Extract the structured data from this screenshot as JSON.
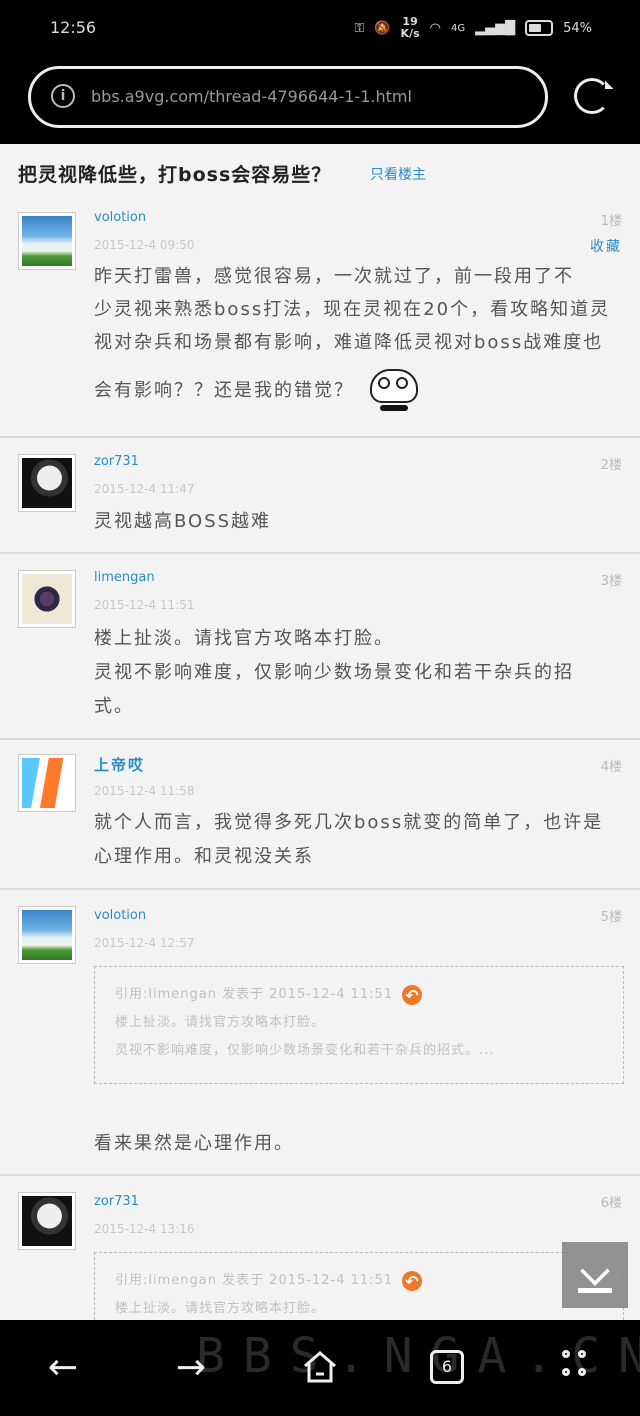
{
  "status_bar": {
    "time": "12:56",
    "net_speed": "19",
    "net_unit": "K/s",
    "network_type": "4G",
    "battery": "54%"
  },
  "browser": {
    "url": "bbs.a9vg.com/thread-4796644-1-1.html"
  },
  "thread": {
    "title": "把灵视降低些，打boss会容易些？",
    "op_only_label": "只看楼主",
    "fav_label": "收藏"
  },
  "posts": [
    {
      "username": "volotion",
      "floor": "1楼",
      "time": "2015-12-4 09:50",
      "lines": [
        "昨天打雷兽，感觉很容易，一次就过了，前一段用了不",
        "少灵视来熟悉boss打法，现在灵视在20个，看攻略知道灵",
        "视对杂兵和场景都有影响，难道降低灵视对boss战难度也",
        "会有影响？？还是我的错觉？"
      ]
    },
    {
      "username": "zor731",
      "floor": "2楼",
      "time": "2015-12-4 11:47",
      "lines": [
        "灵视越高BOSS越难"
      ]
    },
    {
      "username": "limengan",
      "floor": "3楼",
      "time": "2015-12-4 11:51",
      "lines": [
        "楼上扯淡。请找官方攻略本打脸。",
        "灵视不影响难度，仅影响少数场景变化和若干杂兵的招",
        "式。"
      ]
    },
    {
      "username": "上帝哎",
      "floor": "4楼",
      "time": "2015-12-4 11:58",
      "lines": [
        "就个人而言，我觉得多死几次boss就变的简单了，也许是",
        "心理作用。和灵视没关系"
      ]
    },
    {
      "username": "volotion",
      "floor": "5楼",
      "time": "2015-12-4 12:57",
      "quote": {
        "header": "引用:limengan 发表于 2015-12-4 11:51",
        "line1": "楼上扯淡。请找官方攻略本打脸。",
        "line2": "灵视不影响难度，仅影响少数场景变化和若干杂兵的招式。..."
      },
      "lines": [
        "看来果然是心理作用。"
      ]
    },
    {
      "username": "zor731",
      "floor": "6楼",
      "time": "2015-12-4 13:16",
      "quote": {
        "header": "引用:limengan 发表于 2015-12-4 11:51",
        "line1": "楼上扯淡。请找官方攻略本打脸。"
      }
    }
  ],
  "bottom_bar": {
    "watermark": "BBS.NGA.CN",
    "tab_count": "6"
  }
}
